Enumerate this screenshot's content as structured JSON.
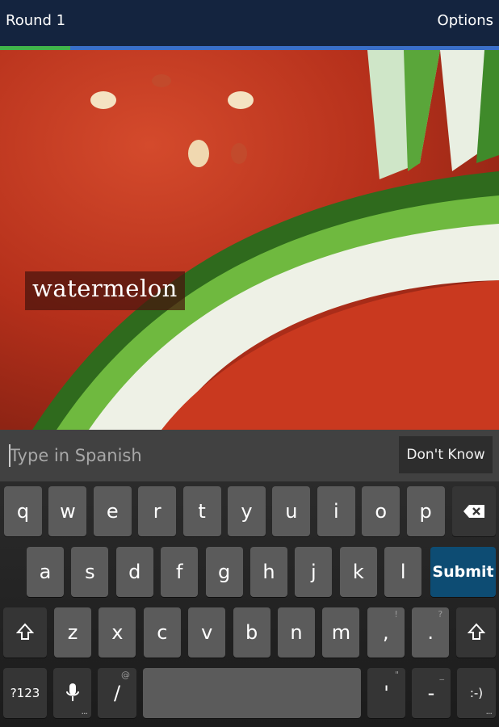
{
  "header": {
    "round_label": "Round 1",
    "options_label": "Options",
    "progress": 0.14,
    "colors": {
      "bar": "#14243f",
      "progress_fill": "#41b44a",
      "progress_track": "#3a6fc8"
    }
  },
  "prompt": {
    "word": "watermelon",
    "image_subject": "watermelon slices photo"
  },
  "answer": {
    "placeholder": "Type in Spanish",
    "value": "",
    "dont_know_label": "Don't Know"
  },
  "keyboard": {
    "row1": [
      "q",
      "w",
      "e",
      "r",
      "t",
      "y",
      "u",
      "i",
      "o",
      "p"
    ],
    "row2": [
      "a",
      "s",
      "d",
      "f",
      "g",
      "h",
      "j",
      "k",
      "l"
    ],
    "row3": [
      "z",
      "x",
      "c",
      "v",
      "b",
      "n",
      "m",
      ",",
      "."
    ],
    "row3_hints": [
      "",
      "",
      "",
      "",
      "",
      "",
      "",
      "!",
      "?"
    ],
    "submit_label": "Submit",
    "symbols_label": "?123",
    "slash_label": "/",
    "slash_hint": "@",
    "apostrophe_label": "'",
    "apostrophe_hint": "\"",
    "dash_label": "-",
    "dash_hint": "_",
    "smiley_label": ":-)",
    "more_dots": "...",
    "icons": {
      "backspace": "backspace-icon",
      "shift": "shift-icon",
      "mic": "microphone-icon"
    },
    "colors": {
      "submit": "#0d4c73",
      "key": "#5b5b5b"
    }
  }
}
